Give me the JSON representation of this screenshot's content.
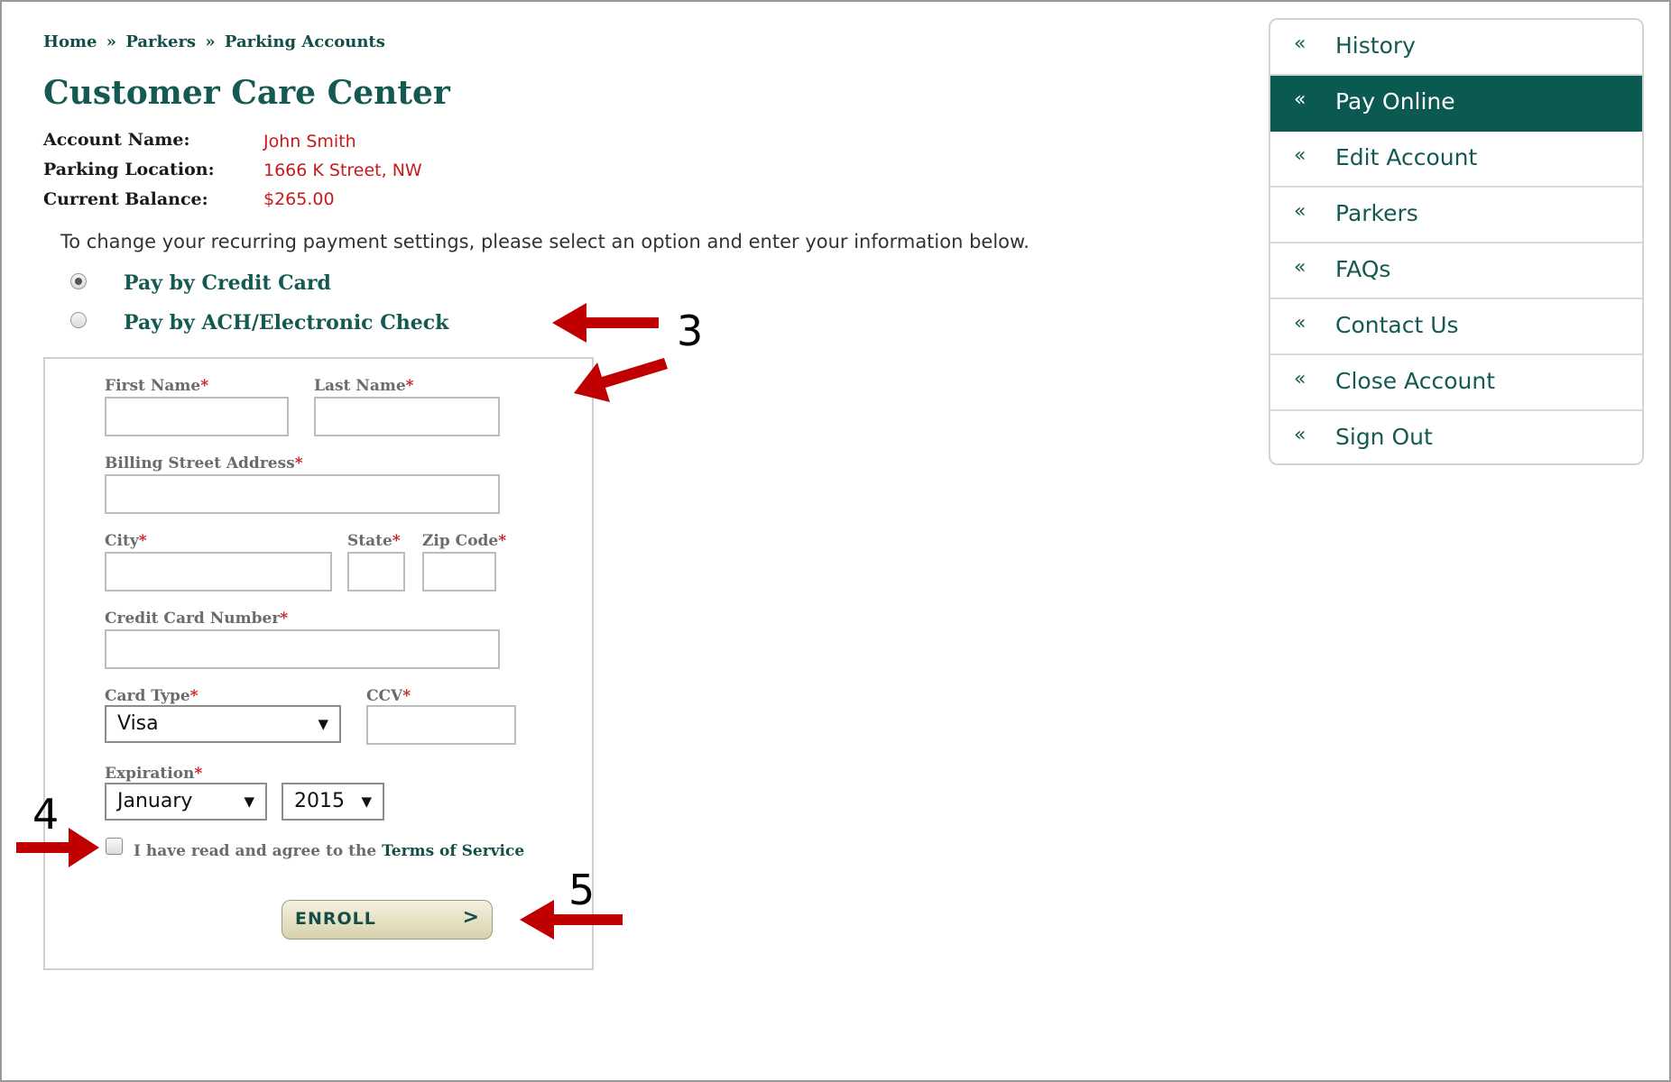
{
  "breadcrumb": {
    "home": "Home",
    "separator": "»",
    "parkers": "Parkers",
    "current": "Parking Accounts"
  },
  "page_title": "Customer Care Center",
  "account": {
    "name_label": "Account Name:",
    "name_value": "John Smith",
    "location_label": "Parking Location:",
    "location_value": "1666 K Street, NW",
    "balance_label": "Current Balance:",
    "balance_value": "$265.00"
  },
  "instructions": "To change your recurring payment settings, please select an option and enter your information below.",
  "payment_options": [
    {
      "label": "Pay by Credit Card",
      "selected": true
    },
    {
      "label": "Pay by ACH/Electronic Check",
      "selected": false
    }
  ],
  "form": {
    "required_mark": "*",
    "first_name_label": "First Name",
    "first_name_value": "",
    "last_name_label": "Last Name",
    "last_name_value": "",
    "street_label": "Billing Street Address",
    "street_value": "",
    "city_label": "City",
    "city_value": "",
    "state_label": "State",
    "state_value": "",
    "zip_label": "Zip Code",
    "zip_value": "",
    "card_number_label": "Credit Card Number",
    "card_number_value": "",
    "card_type_label": "Card Type",
    "card_type_value": "Visa",
    "ccv_label": "CCV",
    "ccv_value": "",
    "expiration_label": "Expiration",
    "exp_month_value": "January",
    "exp_year_value": "2015",
    "agree_text": "I have read and agree to the",
    "agree_link": "Terms of Service",
    "agree_checked": false,
    "enroll_label": "ENROLL",
    "enroll_chevron": ">"
  },
  "sidebar": {
    "icon": "«",
    "items": [
      {
        "label": "History",
        "active": false
      },
      {
        "label": "Pay Online",
        "active": true
      },
      {
        "label": "Edit Account",
        "active": false
      },
      {
        "label": "Parkers",
        "active": false
      },
      {
        "label": "FAQs",
        "active": false
      },
      {
        "label": "Contact Us",
        "active": false
      },
      {
        "label": "Close Account",
        "active": false
      },
      {
        "label": "Sign Out",
        "active": false
      }
    ]
  },
  "annotations": {
    "step3": "3",
    "step4": "4",
    "step5": "5",
    "arrow_color": "#c00000"
  },
  "colors": {
    "brand_green": "#155a52",
    "active_nav_bg": "#0b5a52",
    "account_value_red": "#c81a1a",
    "required_red": "#c81a1a"
  },
  "select_arrow_icon": "▼"
}
